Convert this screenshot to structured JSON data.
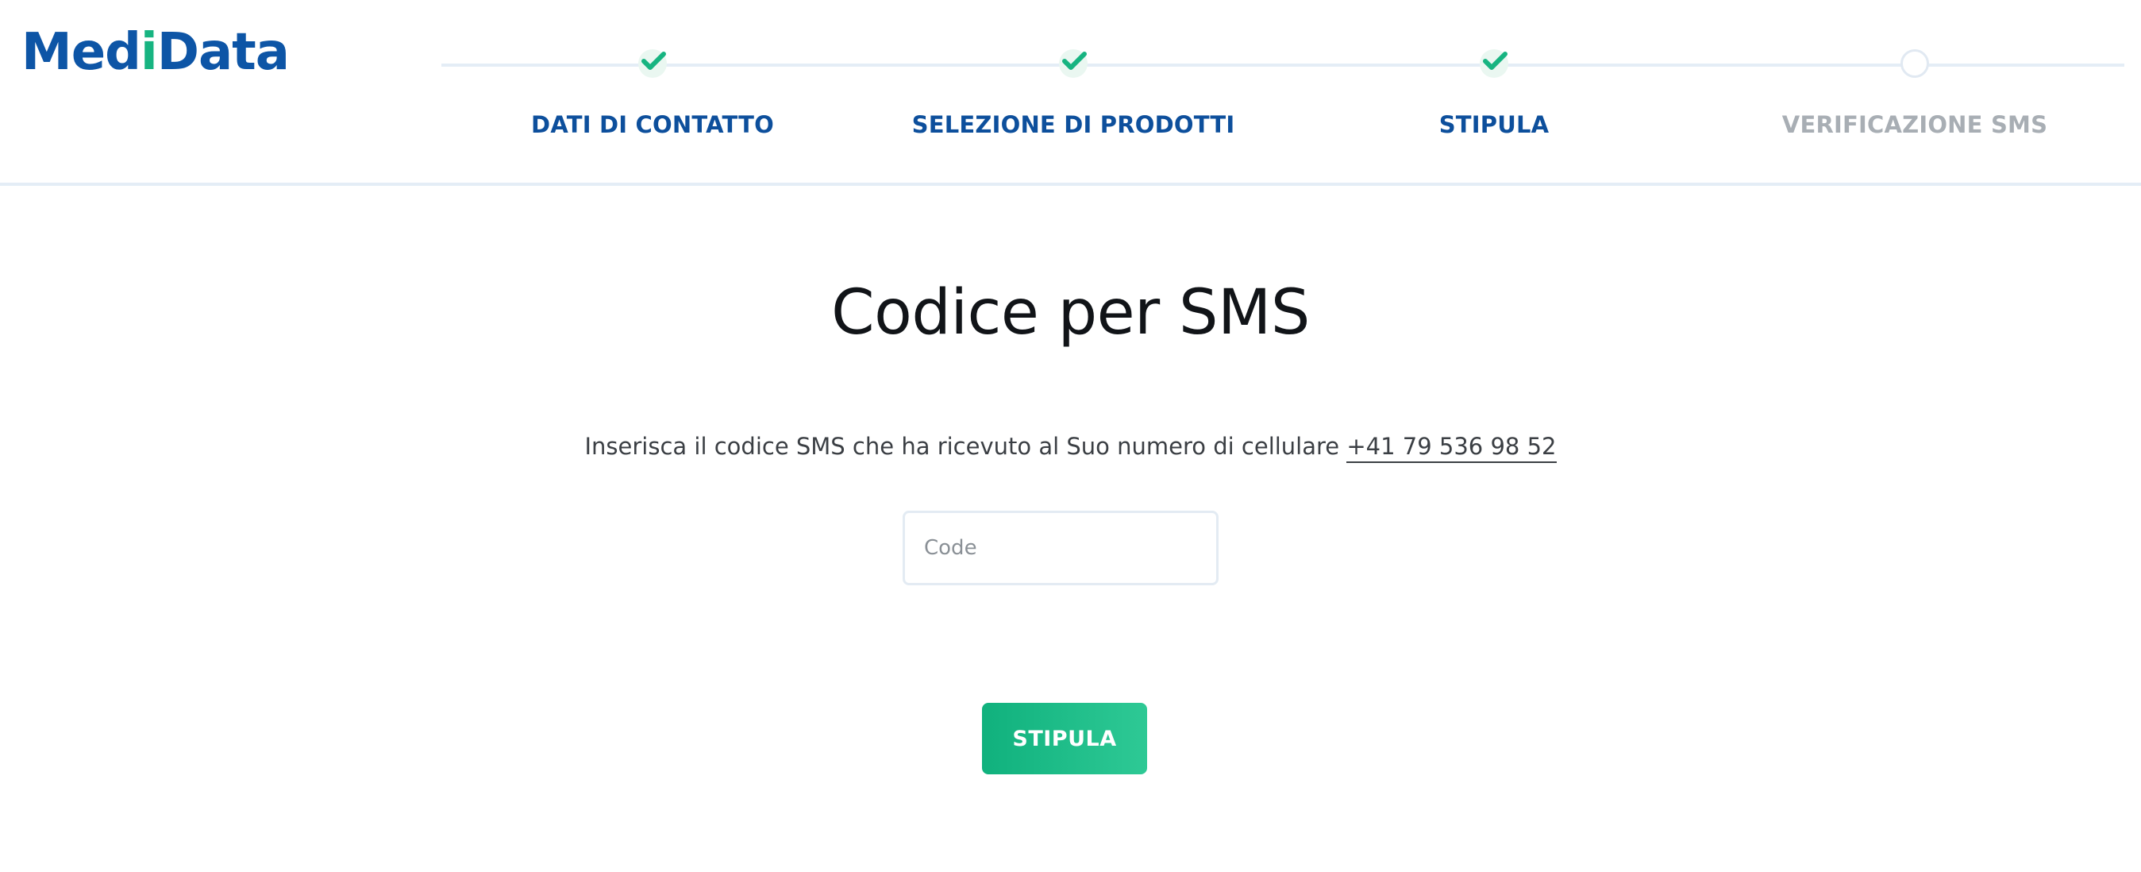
{
  "header": {
    "logo": {
      "part1": "Med",
      "part2": "i",
      "part3": "Data"
    },
    "steps": [
      {
        "label": "DATI DI CONTATTO",
        "status": "completed",
        "icon": "checkmark-icon"
      },
      {
        "label": "SELEZIONE DI PRODOTTI",
        "status": "completed",
        "icon": "checkmark-icon"
      },
      {
        "label": "STIPULA",
        "status": "completed",
        "icon": "checkmark-icon"
      },
      {
        "label": "VERIFICAZIONE SMS",
        "status": "pending",
        "icon": "empty-circle-icon"
      }
    ]
  },
  "main": {
    "title": "Codice per SMS",
    "instruction": "Inserisca il codice SMS che ha ricevuto al Suo numero di cellulare",
    "phone_number": "+41 79 536 98 52",
    "code_input": {
      "placeholder": "Code",
      "value": ""
    },
    "submit_label": "STIPULA"
  },
  "colors": {
    "brand_blue": "#0d55a6",
    "step_active": "#0d4f9c",
    "step_inactive": "#a8aeb4",
    "accent_green": "#17b481",
    "button_gradient_start": "#10b17d",
    "button_gradient_end": "#2ec995",
    "divider": "#e4edf6"
  }
}
